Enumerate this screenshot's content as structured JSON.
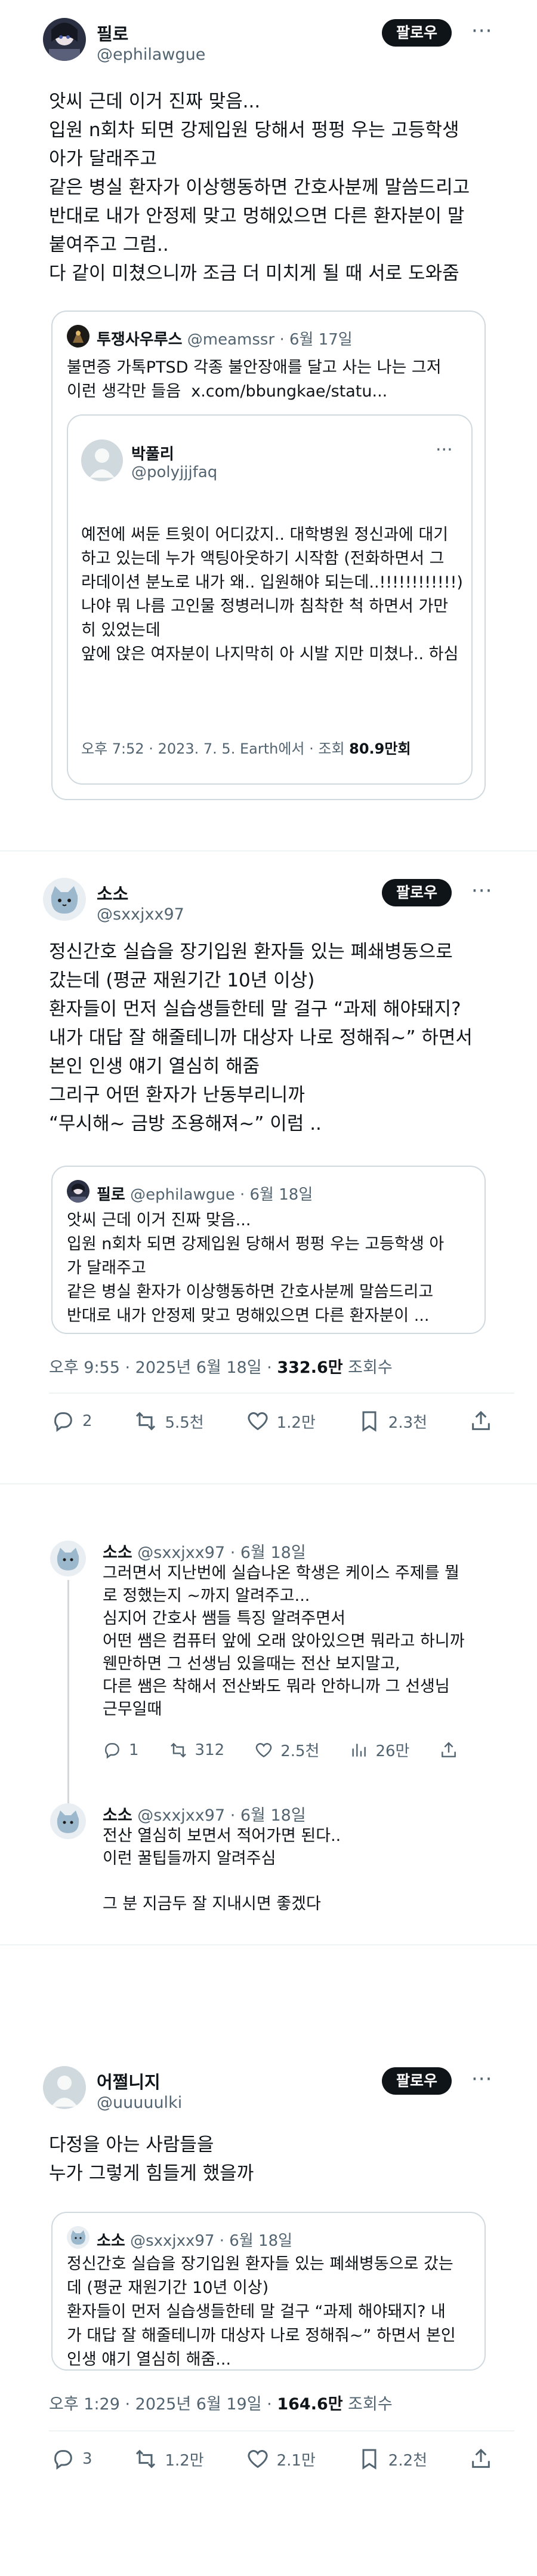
{
  "post1": {
    "name": "필로",
    "handle": "@ephilawgue",
    "follow": "팔로우",
    "more": "···",
    "text": "앗씨 근데 이거 진짜 맞음...\n입원 n회차 되면 강제입원 당해서 펑펑 우는 고등학생\n아가 달래주고\n같은 병실 환자가 이상행동하면 간호사분께 말씀드리고\n반대로 내가 안정제 맞고 멍해있으면 다른 환자분이 말\n붙여주고 그럼..\n다 같이 미쳤으니까 조금 더 미치게 될 때 서로 도와줌",
    "quote": {
      "name": "투쟁사우루스",
      "handle": "@meamssr",
      "date": "· 6월 17일",
      "text": "불면증 가톡PTSD 각종 불안장애를 달고 사는 나는 그저\n이런 생각만 들음  x.com/bbungkae/statu...",
      "nested": {
        "name": "박풀리",
        "handle": "@polyjjjfaq",
        "more": "···",
        "text": "예전에 써둔 트윗이 어디갔지.. 대학병원 정신과에 대기\n하고 있는데 누가 액팅아웃하기 시작함 (전화하면서 그\n라데이션 분노로 내가 왜.. 입원해야 되는데..!!!!!!!!!!!!)\n나야 뭐 나름 고인물 정병러니까 침착한 척 하면서 가만\n히 있었는데\n앞에 앉은 여자분이 나지막히 아 시발 지만 미쳤나.. 하심",
        "meta_prefix": "오후 7:52 · 2023. 7. 5. Earth에서 · 조회 ",
        "views": "80.9만회"
      }
    }
  },
  "post2": {
    "name": "소소",
    "handle": "@sxxjxx97",
    "follow": "팔로우",
    "more": "···",
    "text": "정신간호 실습을 장기입원 환자들 있는 폐쇄병동으로\n갔는데 (평균 재원기간 10년 이상)\n환자들이 먼저 실습생들한테 말 걸구 “과제 해야돼지?\n내가 대답 잘 해줄테니까 대상자 나로 정해줘~” 하면서\n본인 인생 얘기 열심히 해줌\n그리구 어떤 환자가 난동부리니까\n“무시해~ 금방 조용해져~” 이럼 ..",
    "quote": {
      "name": "필로",
      "handle": "@ephilawgue",
      "date": "· 6월 18일",
      "text": "앗씨 근데 이거 진짜 맞음...\n입원 n회차 되면 강제입원 당해서 펑펑 우는 고등학생 아\n가 달래주고\n같은 병실 환자가 이상행동하면 간호사분께 말씀드리고\n반대로 내가 안정제 맞고 멍해있으면 다른 환자분이 ..."
    },
    "meta_prefix": "오후 9:55 · 2025년 6월 18일 · ",
    "views": "332.6만",
    "views_suffix": " 조회수",
    "stats": {
      "reply": "2",
      "retweet": "5.5천",
      "like": "1.2만",
      "bookmark": "2.3천"
    }
  },
  "thread": {
    "r1": {
      "name": "소소",
      "handle": "@sxxjxx97",
      "date": "· 6월 18일",
      "text": "그러면서 지난번에 실습나온 학생은 케이스 주제를 뭘\n로 정했는지 ~까지 알려주고...\n심지어 간호사 쌤들 특징 알려주면서\n어떤 쌤은 컴퓨터 앞에 오래 앉아있으면 뭐라고 하니까\n웬만하면 그 선생님 있을때는 전산 보지말고,\n다른 쌤은 착해서 전산봐도 뭐라 안하니까 그 선생님\n근무일때",
      "stats": {
        "reply": "1",
        "retweet": "312",
        "like": "2.5천",
        "views": "26만"
      }
    },
    "r2": {
      "name": "소소",
      "handle": "@sxxjxx97",
      "date": "· 6월 18일",
      "text": "전산 열심히 보면서 적어가면 된다..\n이런 꿀팁들까지 알려주심\n\n그 분 지금두 잘 지내시면 좋겠다"
    }
  },
  "post3": {
    "name": "어쩔니지",
    "handle": "@uuuuulki",
    "follow": "팔로우",
    "more": "···",
    "text": "다정을 아는 사람들을\n누가 그렇게 힘들게 했을까",
    "quote": {
      "name": "소소",
      "handle": "@sxxjxx97",
      "date": "· 6월 18일",
      "text": "정신간호 실습을 장기입원 환자들 있는 폐쇄병동으로 갔는\n데 (평균 재원기간 10년 이상)\n환자들이 먼저 실습생들한테 말 걸구 “과제 해야돼지? 내\n가 대답 잘 해줄테니까 대상자 나로 정해줘~” 하면서 본인\n인생 얘기 열심히 해줌..."
    },
    "meta_prefix": "오후 1:29 · 2025년 6월 19일 · ",
    "views": "164.6만",
    "views_suffix": " 조회수",
    "stats": {
      "reply": "3",
      "retweet": "1.2만",
      "like": "2.1만",
      "bookmark": "2.2천"
    }
  },
  "colors": {
    "text": "#0f1419",
    "muted": "#536471",
    "border": "#cfd9de",
    "divider": "#eff3f4"
  }
}
